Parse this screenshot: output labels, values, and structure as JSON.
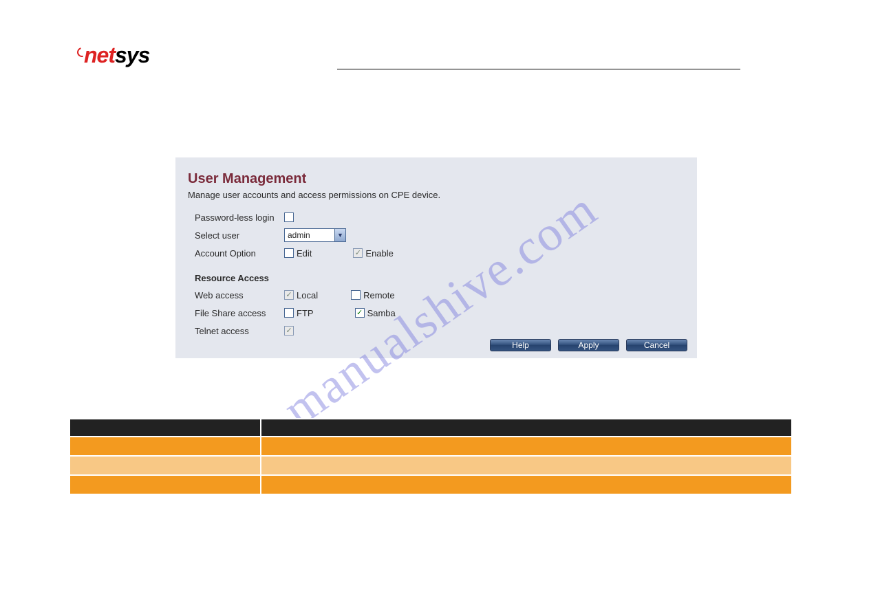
{
  "logo": {
    "part1": "net",
    "part2": "sys"
  },
  "panel": {
    "title": "User Management",
    "subtitle": "Manage user accounts and access permissions on CPE device.",
    "passwordless_label": "Password-less login",
    "selectuser_label": "Select user",
    "selectuser_value": "admin",
    "accountoption_label": "Account Option",
    "edit_label": "Edit",
    "enable_label": "Enable",
    "resource_head": "Resource Access",
    "web_label": "Web access",
    "local_label": "Local",
    "remote_label": "Remote",
    "fileshare_label": "File Share access",
    "ftp_label": "FTP",
    "samba_label": "Samba",
    "telnet_label": "Telnet access",
    "buttons": {
      "help": "Help",
      "apply": "Apply",
      "cancel": "Cancel"
    }
  },
  "watermark": "manualshive.com",
  "table": {
    "h1": "",
    "h2": "",
    "r1c1": "",
    "r1c2": "",
    "r2c1": "",
    "r2c2": "",
    "r3c1": "",
    "r3c2": ""
  }
}
